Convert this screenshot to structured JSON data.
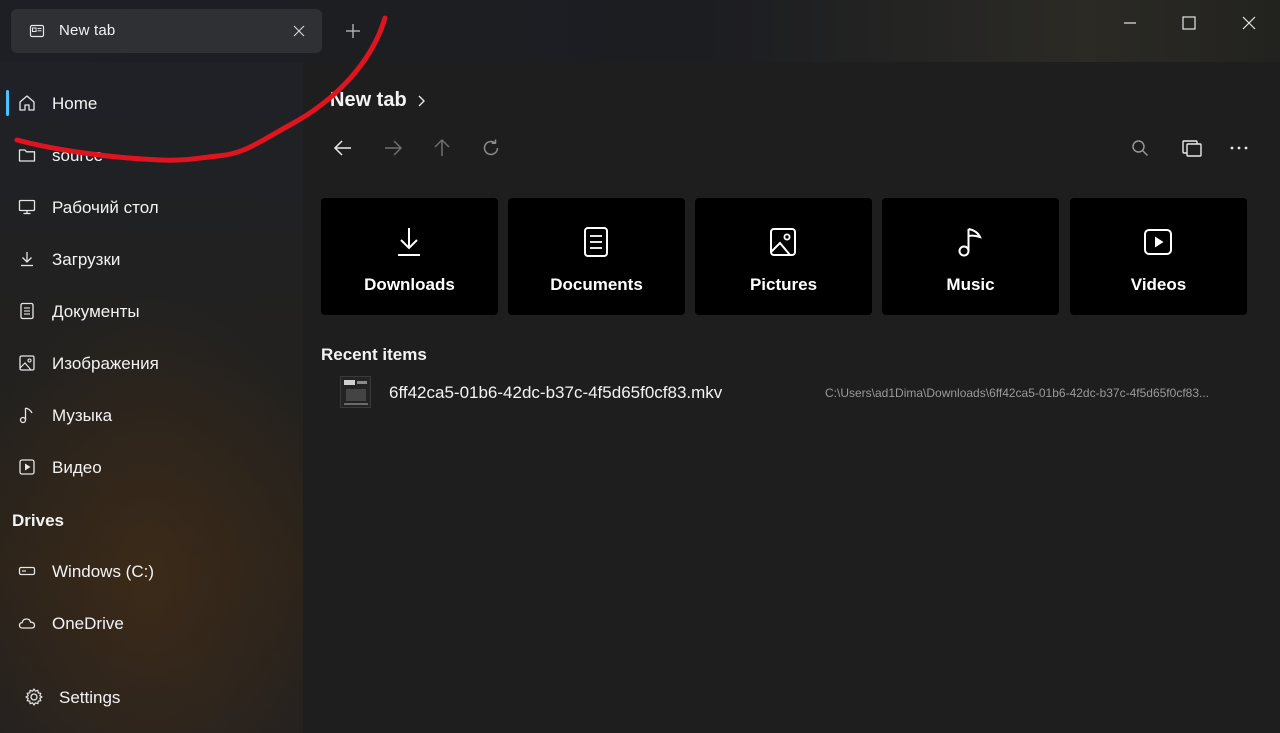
{
  "window": {
    "tab_title": "New tab",
    "tab_icon": "tab-page-icon",
    "new_tab_icon": "plus-icon",
    "controls": [
      "minimize-icon",
      "maximize-icon",
      "close-icon"
    ]
  },
  "sidebar": {
    "items": [
      {
        "label": "Home",
        "icon": "home-icon",
        "selected": true
      },
      {
        "label": "source",
        "icon": "folder-icon"
      },
      {
        "label": "Рабочий стол",
        "icon": "desktop-icon"
      },
      {
        "label": "Загрузки",
        "icon": "download-icon"
      },
      {
        "label": "Документы",
        "icon": "document-icon"
      },
      {
        "label": "Изображения",
        "icon": "image-icon"
      },
      {
        "label": "Музыка",
        "icon": "music-icon"
      },
      {
        "label": "Видео",
        "icon": "video-icon"
      }
    ],
    "drives_heading": "Drives",
    "drives": [
      {
        "label": "Windows (C:)",
        "icon": "drive-icon"
      },
      {
        "label": "OneDrive",
        "icon": "cloud-icon"
      }
    ],
    "settings_label": "Settings",
    "accent_color": "#4cc2ff"
  },
  "main": {
    "breadcrumb": "New tab",
    "toolbar": [
      "back-arrow-icon",
      "forward-arrow-icon",
      "up-arrow-icon",
      "refresh-icon",
      "search-icon",
      "multi-window-icon",
      "more-options-icon"
    ],
    "quick_access": [
      {
        "label": "Downloads",
        "icon": "download-icon"
      },
      {
        "label": "Documents",
        "icon": "document-icon"
      },
      {
        "label": "Pictures",
        "icon": "image-icon"
      },
      {
        "label": "Music",
        "icon": "music-icon"
      },
      {
        "label": "Videos",
        "icon": "video-icon"
      }
    ],
    "recent_heading": "Recent items",
    "recent_files": [
      {
        "name": "6ff42ca5-01b6-42dc-b37c-4f5d65f0cf83.mkv",
        "path": "C:\\Users\\ad1Dima\\Downloads\\6ff42ca5-01b6-42dc-b37c-4f5d65f0cf83..."
      }
    ]
  },
  "annotation_color": "#e0141e"
}
